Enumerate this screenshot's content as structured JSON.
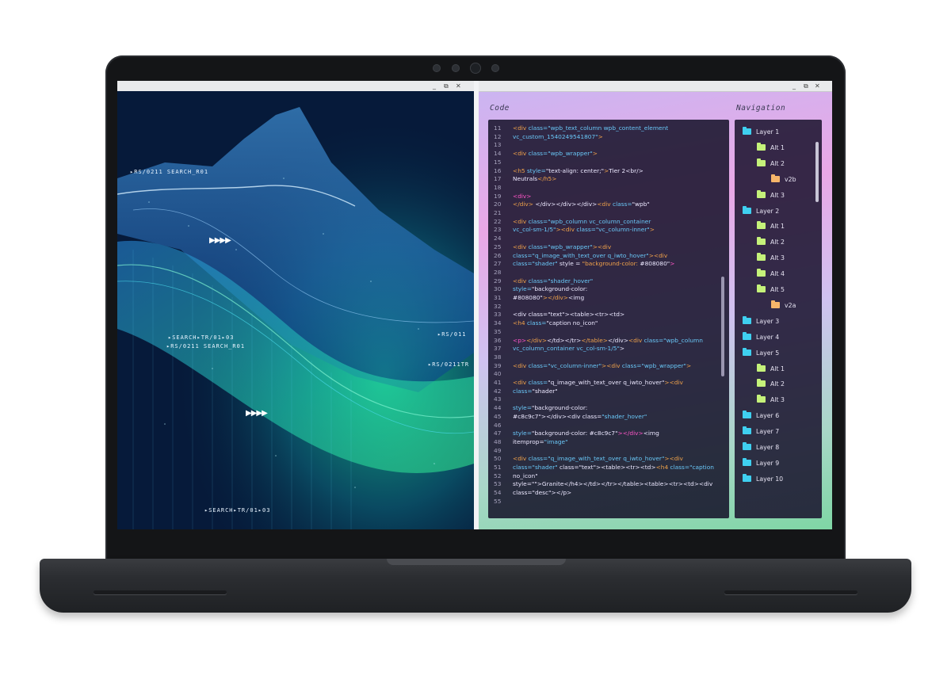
{
  "left_window": {
    "controls": [
      "_",
      "⧉",
      "✕"
    ],
    "hud_labels": [
      "▸RS/0211 SEARCH_R01",
      "▸SEARCH▸TR/01▸03",
      "▸RS/0211 SEARCH_R01",
      "▸RS/011",
      "▸RS/0211TR",
      "▸SEARCH▸TR/01▸03"
    ],
    "arrows": [
      "▶▶▶▶",
      "▶▶▶▶"
    ]
  },
  "right_window": {
    "controls": [
      "_",
      "⧉",
      "✕"
    ],
    "code_label": "Code",
    "navigation_label": "Navigation",
    "code_lines": [
      {
        "n": "11",
        "h": "  <span class='t'>&lt;div</span> <span class='a'>class=</span><span class='a'>\"wpb_text_column wpb_content_element</span>"
      },
      {
        "n": "12",
        "h": "<span class='a'>vc_custom_1540249541807\"</span><span class='t'>&gt;</span>"
      },
      {
        "n": "13",
        "h": ""
      },
      {
        "n": "14",
        "h": "<span class='t'>&lt;div</span> <span class='a'>class=\"wpb_wrapper\"</span><span class='t'>&gt;</span>"
      },
      {
        "n": "15",
        "h": ""
      },
      {
        "n": "16",
        "h": "<span class='t'>&lt;h5</span> <span class='a'>style=</span><span class='s'>\"text-align: center;\"</span><span class='t'>&gt;</span><span class='s'>Tier 2&lt;br/&gt;</span>"
      },
      {
        "n": "17",
        "h": "<span class='s'>Neutrals</span><span class='t'>&lt;/h5&gt;</span>"
      },
      {
        "n": "18",
        "h": ""
      },
      {
        "n": "19",
        "h": "<span class='p'>&lt;div&gt;</span>"
      },
      {
        "n": "20",
        "h": "<span class='t'>&lt;/div&gt;</span> <span class='s'>&lt;/div&gt;&lt;/div&gt;&lt;/div&gt;</span><span class='t'>&lt;div</span> <span class='a'>class=</span><span class='s'>\"wpb\"</span>"
      },
      {
        "n": "21",
        "h": ""
      },
      {
        "n": "22",
        "h": "<span class='t'>&lt;div</span> <span class='a'>class=\"wpb_column vc_column_container</span>"
      },
      {
        "n": "23",
        "h": "<span class='a'>vc_col-sm-1/5\"</span><span class='t'>&gt;&lt;div</span> <span class='a'>class=\"vc_column-inner\"</span><span class='t'>&gt;</span>"
      },
      {
        "n": "24",
        "h": ""
      },
      {
        "n": "25",
        "h": "<span class='t'>&lt;div</span> <span class='a'>class=\"wpb_wrapper\"</span><span class='t'>&gt;&lt;div</span>"
      },
      {
        "n": "26",
        "h": "<span class='a'>class=\"q_image_with_text_over q_iwto_hover\"</span><span class='t'>&gt;&lt;div</span>"
      },
      {
        "n": "27",
        "h": "<span class='a'>class=\"shader\"</span> <span class='s'>style = </span><span class='t'>\"background-color:</span> <span class='s'>#808080\"</span><span class='p'>&gt;</span>"
      },
      {
        "n": "28",
        "h": ""
      },
      {
        "n": "29",
        "h": "<span class='t'>&lt;div</span> <span class='a'>class=\"shader_hover\"</span>"
      },
      {
        "n": "30",
        "h": "<span class='a'>style=</span><span class='s'>\"background-color:</span>"
      },
      {
        "n": "31",
        "h": "<span class='s'>#808080\"</span><span class='t'>&gt;&lt;/div&gt;</span><span class='s'>&lt;img</span>"
      },
      {
        "n": "32",
        "h": ""
      },
      {
        "n": "33",
        "h": "<span class='s'>&lt;div class=\"text\"&gt;&lt;table&gt;&lt;tr&gt;&lt;td&gt;</span>"
      },
      {
        "n": "34",
        "h": "<span class='t'>&lt;h4</span> <span class='a'>class=</span><span class='s'>\"caption no_icon\"</span>"
      },
      {
        "n": "35",
        "h": ""
      },
      {
        "n": "36",
        "h": "<span class='p'>&lt;p&gt;</span><span class='t'>&lt;/div&gt;</span><span class='s'>&lt;/td&gt;&lt;/tr&gt;</span><span class='t'>&lt;/table&gt;</span><span class='s'>&lt;/div&gt;</span><span class='t'>&lt;div</span> <span class='a'>class=\"wpb_column</span>"
      },
      {
        "n": "37",
        "h": "<span class='a'>vc_column_container vc_col-sm-1/5\"</span><span class='s'>&gt;</span>"
      },
      {
        "n": "38",
        "h": ""
      },
      {
        "n": "39",
        "h": "<span class='t'>&lt;div</span>  <span class='a'>class=\"vc_column-inner\"</span><span class='t'>&gt;&lt;div</span> <span class='a'>class=\"wpb_wrapper\"</span><span class='t'>&gt;</span>"
      },
      {
        "n": "40",
        "h": ""
      },
      {
        "n": "41",
        "h": "<span class='t'>&lt;div</span> <span class='a'>class=</span><span class='s'>\"q_image_with_text_over q_iwto_hover\"</span><span class='t'>&gt;&lt;div</span>"
      },
      {
        "n": "42",
        "h": "<span class='a'>class=</span><span class='s'>\"shader\"</span>"
      },
      {
        "n": "43",
        "h": ""
      },
      {
        "n": "44",
        "h": "<span class='a'>style=</span><span class='s'>\"background-color:</span>"
      },
      {
        "n": "45",
        "h": "<span class='s'>#c8c9c7\"&gt;&lt;/div&gt;&lt;div class=</span><span class='a'>\"shader_hover\"</span>"
      },
      {
        "n": "46",
        "h": ""
      },
      {
        "n": "47",
        "h": "<span class='a'>style=</span><span class='s'>\"background-color: #c8c9c7\"</span><span class='p'>&gt;&lt;/div&gt;</span><span class='s'>&lt;img</span>"
      },
      {
        "n": "48",
        "h": "<span class='s'>itemprop=</span><span class='a'>\"image\"</span>"
      },
      {
        "n": "49",
        "h": ""
      },
      {
        "n": "50",
        "h": "<span class='t'>&lt;div</span> <span class='a'>class=\"q_image_with_text_over q_iwto_hover\"</span><span class='t'>&gt;&lt;div</span>"
      },
      {
        "n": "51",
        "h": "<span class='a'>class=\"shader\"</span> <span class='s'>class=\"text\"&gt;&lt;table&gt;&lt;tr&gt;&lt;td&gt;</span><span class='t'>&lt;h4</span> <span class='a'>class=\"caption</span>"
      },
      {
        "n": "52",
        "h": "<span class='s'>no_icon\"</span>"
      },
      {
        "n": "53",
        "h": "<span class='s'>style=\"\"&gt;Granite&lt;/h4&gt;&lt;/td&gt;&lt;/tr&gt;&lt;/table&gt;&lt;table&gt;&lt;tr&gt;&lt;td&gt;&lt;div</span>"
      },
      {
        "n": "54",
        "h": "<span class='s'>class=\"desc\"&gt;&lt;/p&gt;</span>"
      },
      {
        "n": "55",
        "h": ""
      }
    ],
    "nav_items": [
      {
        "label": "Layer 1",
        "level": 0,
        "color": "#3fd0f0"
      },
      {
        "label": "Alt 1",
        "level": 1,
        "color": "#c5f27a"
      },
      {
        "label": "Alt 2",
        "level": 1,
        "color": "#c5f27a"
      },
      {
        "label": "v2b",
        "level": 2,
        "color": "#f6b56a"
      },
      {
        "label": "Alt 3",
        "level": 1,
        "color": "#c5f27a"
      },
      {
        "label": "Layer 2",
        "level": 0,
        "color": "#3fd0f0"
      },
      {
        "label": "Alt 1",
        "level": 1,
        "color": "#c5f27a"
      },
      {
        "label": "Alt 2",
        "level": 1,
        "color": "#c5f27a"
      },
      {
        "label": "Alt 3",
        "level": 1,
        "color": "#c5f27a"
      },
      {
        "label": "Alt 4",
        "level": 1,
        "color": "#c5f27a"
      },
      {
        "label": "Alt 5",
        "level": 1,
        "color": "#c5f27a"
      },
      {
        "label": "v2a",
        "level": 2,
        "color": "#f6b56a"
      },
      {
        "label": "Layer 3",
        "level": 0,
        "color": "#3fd0f0"
      },
      {
        "label": "Layer 4",
        "level": 0,
        "color": "#3fd0f0"
      },
      {
        "label": "Layer 5",
        "level": 0,
        "color": "#3fd0f0"
      },
      {
        "label": "Alt 1",
        "level": 1,
        "color": "#c5f27a"
      },
      {
        "label": "Alt 2",
        "level": 1,
        "color": "#c5f27a"
      },
      {
        "label": "Alt 3",
        "level": 1,
        "color": "#c5f27a"
      },
      {
        "label": "Layer 6",
        "level": 0,
        "color": "#3fd0f0"
      },
      {
        "label": "Layer 7",
        "level": 0,
        "color": "#3fd0f0"
      },
      {
        "label": "Layer 8",
        "level": 0,
        "color": "#3fd0f0"
      },
      {
        "label": "Layer 9",
        "level": 0,
        "color": "#3fd0f0"
      },
      {
        "label": "Layer 10",
        "level": 0,
        "color": "#3fd0f0"
      }
    ]
  }
}
